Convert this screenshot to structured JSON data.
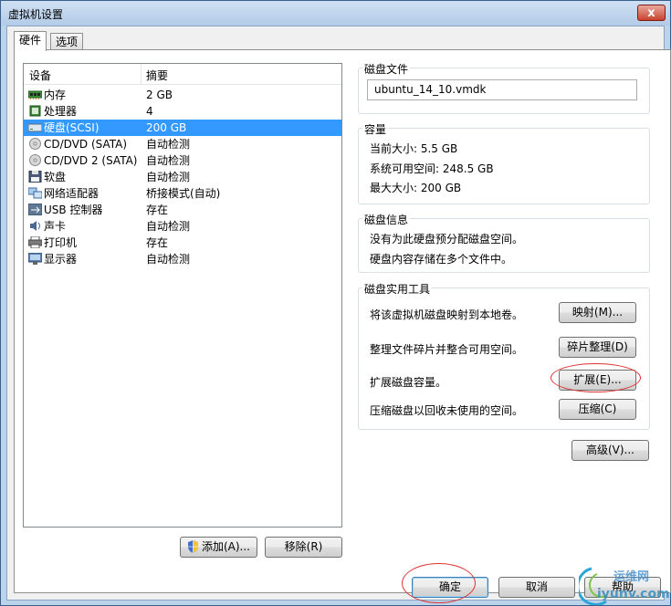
{
  "window": {
    "title": "虚拟机设置",
    "close_label": "x"
  },
  "tabs": [
    {
      "label": "硬件"
    },
    {
      "label": "选项"
    }
  ],
  "device_list": {
    "columns": [
      "设备",
      "摘要"
    ],
    "rows": [
      {
        "icon": "memory-icon",
        "name": "内存",
        "summary": "2 GB"
      },
      {
        "icon": "processor-icon",
        "name": "处理器",
        "summary": "4"
      },
      {
        "icon": "hard-disk-icon",
        "name": "硬盘(SCSI)",
        "summary": "200 GB",
        "selected": true
      },
      {
        "icon": "cd-dvd-icon",
        "name": "CD/DVD (SATA)",
        "summary": "自动检测"
      },
      {
        "icon": "cd-dvd-icon",
        "name": "CD/DVD 2 (SATA)",
        "summary": "自动检测"
      },
      {
        "icon": "floppy-icon",
        "name": "软盘",
        "summary": "自动检测"
      },
      {
        "icon": "network-adapter-icon",
        "name": "网络适配器",
        "summary": "桥接模式(自动)"
      },
      {
        "icon": "usb-icon",
        "name": "USB 控制器",
        "summary": "存在"
      },
      {
        "icon": "sound-card-icon",
        "name": "声卡",
        "summary": "自动检测"
      },
      {
        "icon": "printer-icon",
        "name": "打印机",
        "summary": "存在"
      },
      {
        "icon": "display-icon",
        "name": "显示器",
        "summary": "自动检测"
      }
    ]
  },
  "list_buttons": {
    "add": "添加(A)...",
    "remove": "移除(R)"
  },
  "disk_file": {
    "label": "磁盘文件",
    "value": "ubuntu_14_10.vmdk"
  },
  "capacity": {
    "label": "容量",
    "current": "当前大小: 5.5 GB",
    "available": "系统可用空间: 248.5 GB",
    "max": "最大大小: 200 GB"
  },
  "disk_info": {
    "label": "磁盘信息",
    "line1": "没有为此硬盘预分配磁盘空间。",
    "line2": "硬盘内容存储在多个文件中。"
  },
  "utilities": {
    "label": "磁盘实用工具",
    "map_desc": "将该虚拟机磁盘映射到本地卷。",
    "map_btn": "映射(M)...",
    "defrag_desc": "整理文件碎片并整合可用空间。",
    "defrag_btn": "碎片整理(D)",
    "expand_desc": "扩展磁盘容量。",
    "expand_btn": "扩展(E)...",
    "compact_desc": "压缩磁盘以回收未使用的空间。",
    "compact_btn": "压缩(C)"
  },
  "advanced_btn": "高级(V)...",
  "footer": {
    "ok": "确定",
    "cancel": "取消",
    "help": "帮助"
  },
  "watermark": {
    "line1": "运维网",
    "line2": "iyunv.com"
  },
  "colors": {
    "selection": "#3399ff",
    "annotation": "#e03030"
  }
}
